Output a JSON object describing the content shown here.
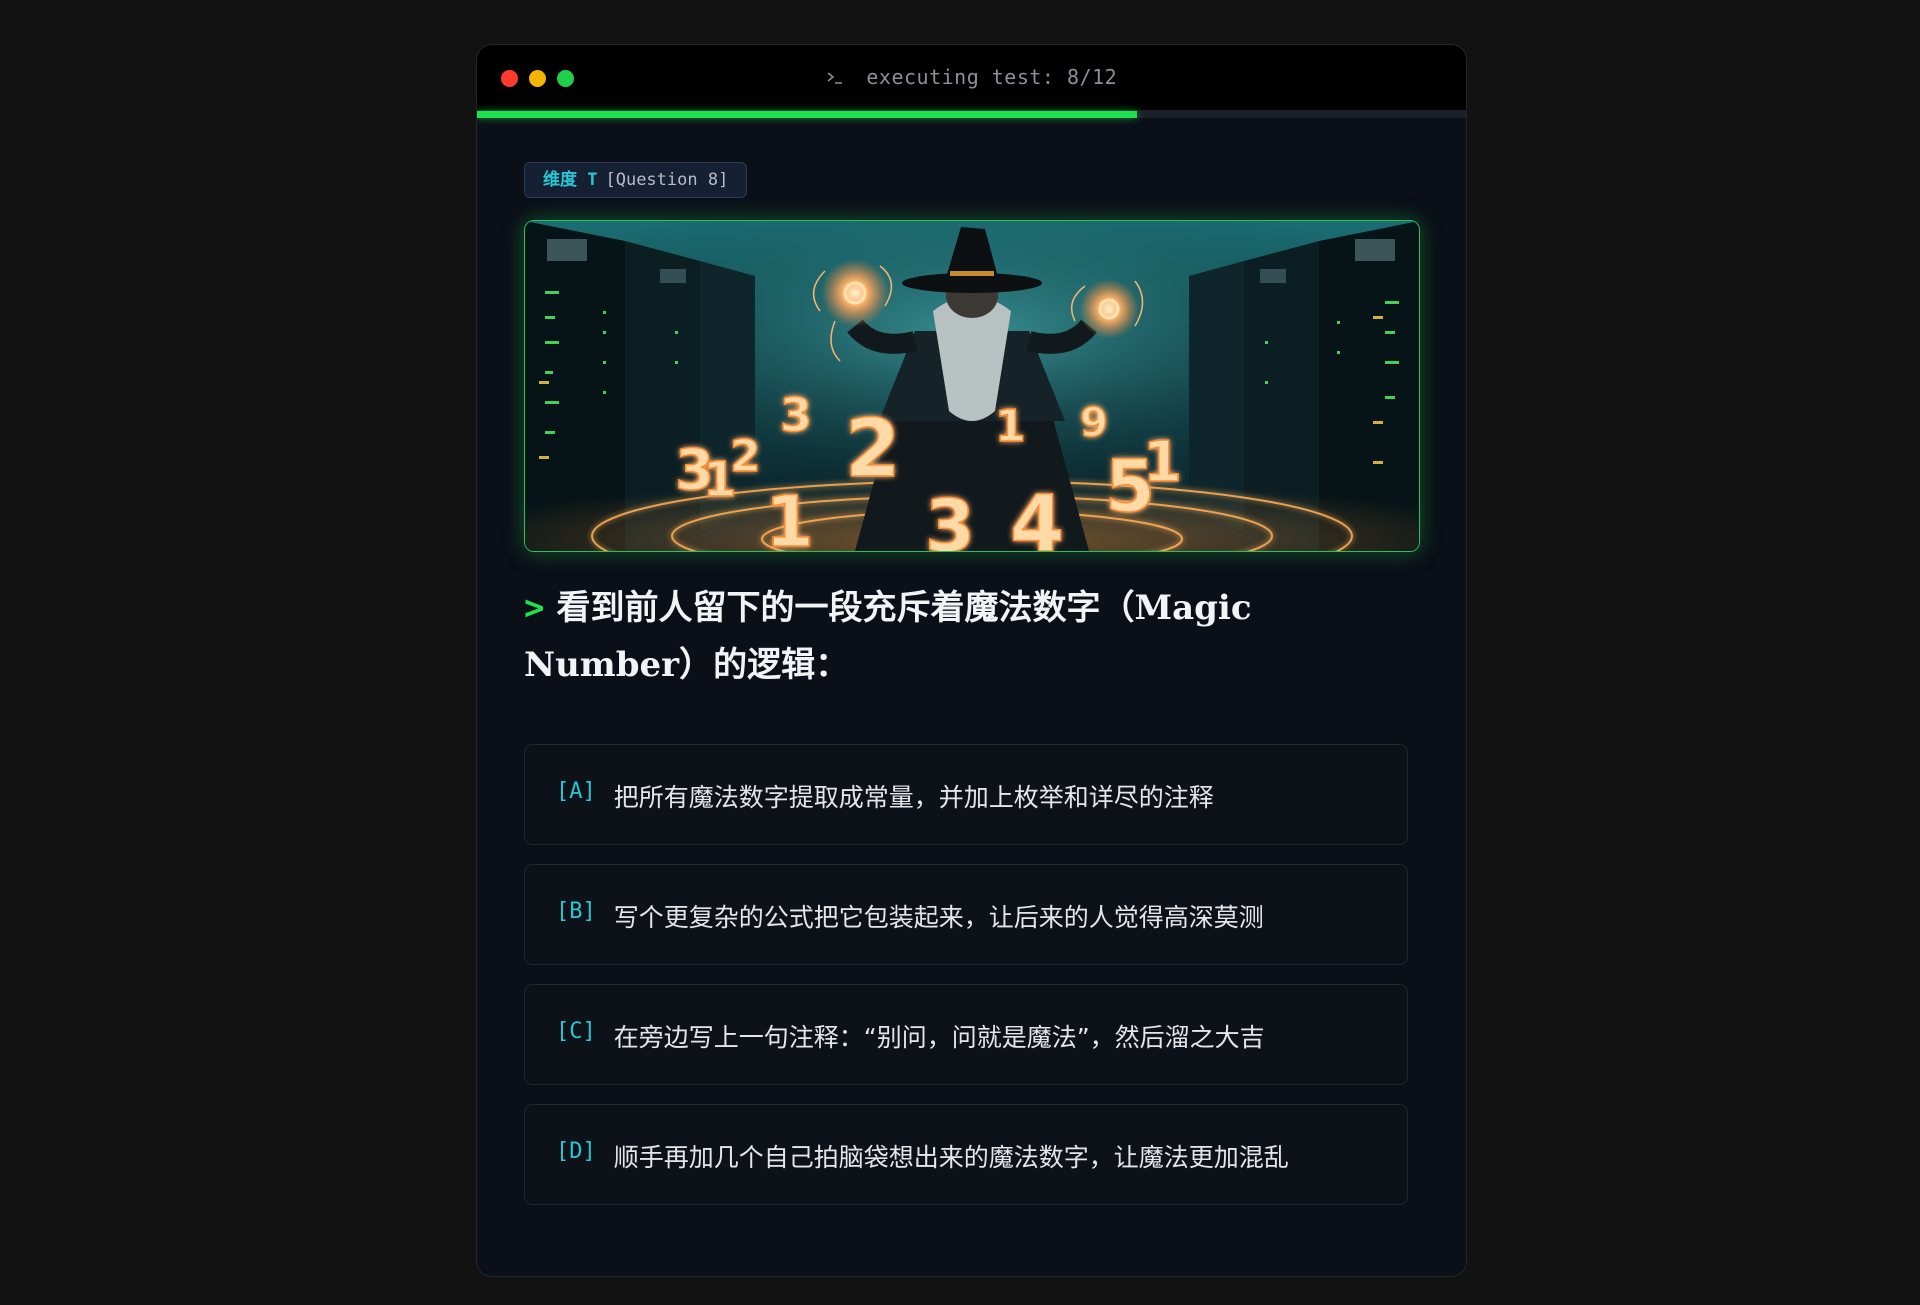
{
  "window": {
    "title": "executing test: 8/12",
    "title_icon": "terminal-prompt-icon",
    "progress": 0.667
  },
  "tag": {
    "dimension_label": "维度 T",
    "question_label": "[Question 8]"
  },
  "hero": {
    "numbers": [
      "3",
      "1",
      "2",
      "3",
      "2",
      "1",
      "3",
      "1",
      "4",
      "9",
      "5",
      "1"
    ]
  },
  "question": {
    "caret": ">",
    "text": "看到前人留下的一段充斥着魔法数字（Magic Number）的逻辑："
  },
  "options": [
    {
      "key": "[A]",
      "text": "把所有魔法数字提取成常量，并加上枚举和详尽的注释"
    },
    {
      "key": "[B]",
      "text": "写个更复杂的公式把它包装起来，让后来的人觉得高深莫测"
    },
    {
      "key": "[C]",
      "text": "在旁边写上一句注释：“别问，问就是魔法”，然后溜之大吉"
    },
    {
      "key": "[D]",
      "text": "顺手再加几个自己拍脑袋想出来的魔法数字，让魔法更加混乱"
    }
  ],
  "colors": {
    "accent_green": "#1fe04f",
    "accent_cyan": "#25c7d6",
    "dot_red": "#ff3b30",
    "dot_yellow": "#f5b400",
    "dot_green": "#1fd14a"
  }
}
